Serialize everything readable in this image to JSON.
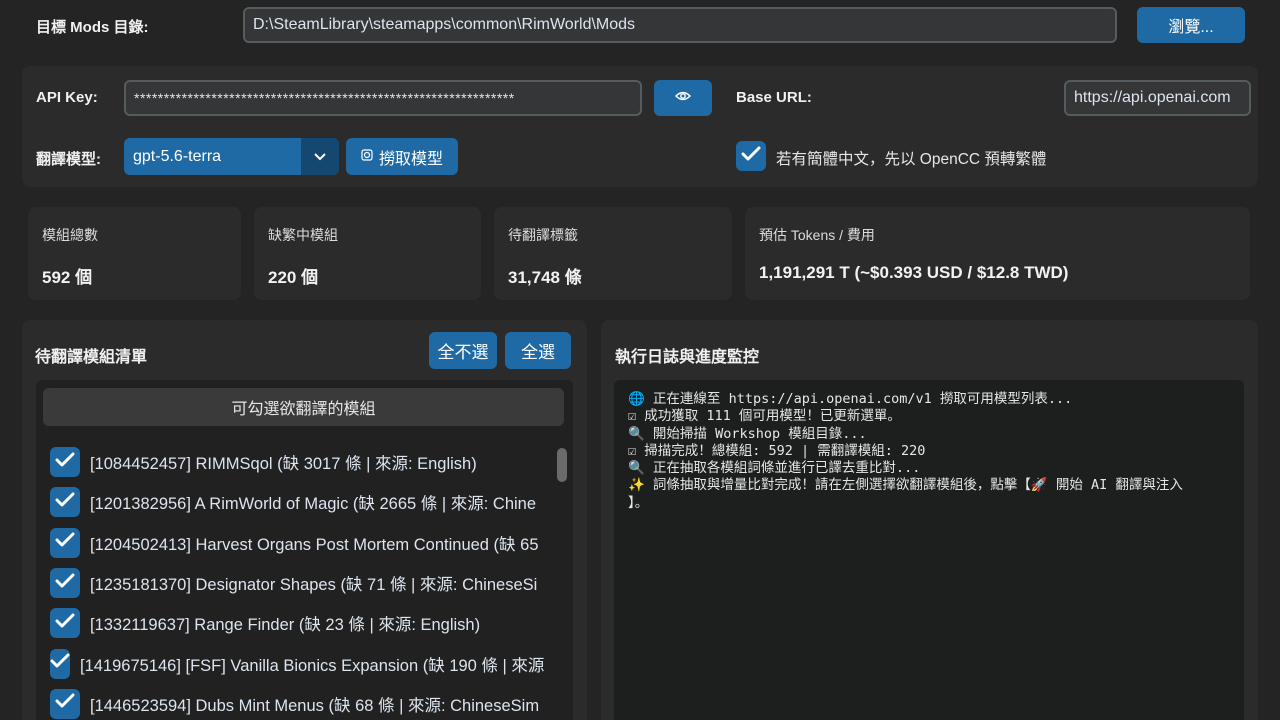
{
  "mods_dir": {
    "label": "目標 Mods 目錄:",
    "value": "D:\\SteamLibrary\\steamapps\\common\\RimWorld\\Mods",
    "browse_label": "瀏覽..."
  },
  "api": {
    "key_label": "API Key:",
    "key_value": "****************************************************************",
    "eye_icon": "eye-icon",
    "base_url_label": "Base URL:",
    "base_url_value": "https://api.openai.com",
    "model_label": "翻譯模型:",
    "model_value": "gpt-5.6-terra",
    "fetch_label": "撈取模型",
    "fetch_icon": "refresh-icon",
    "opencc_label": "若有簡體中文，先以 OpenCC 預轉繁體",
    "opencc_checked": true
  },
  "stats": [
    {
      "title": "模組總數",
      "value": "592 個"
    },
    {
      "title": "缺繁中模組",
      "value": "220 個"
    },
    {
      "title": "待翻譯標籤",
      "value": "31,748 條"
    },
    {
      "title": "預估 Tokens / 費用",
      "value": "1,191,291 T (~$0.393 USD / $12.8 TWD)"
    }
  ],
  "modlist": {
    "title": "待翻譯模組清單",
    "deselect_all": "全不選",
    "select_all": "全選",
    "header": "可勾選欲翻譯的模組",
    "items": [
      {
        "label": "[1084452457] RIMMSqol (缺 3017 條 | 來源: English)",
        "checked": true
      },
      {
        "label": "[1201382956] A RimWorld of Magic (缺 2665 條 | 來源: Chine",
        "checked": true
      },
      {
        "label": "[1204502413] Harvest Organs Post Mortem Continued (缺 65",
        "checked": true
      },
      {
        "label": "[1235181370] Designator Shapes (缺 71 條 | 來源: ChineseSi",
        "checked": true
      },
      {
        "label": "[1332119637] Range Finder (缺 23 條 | 來源: English)",
        "checked": true
      },
      {
        "label": "[1419675146] [FSF] Vanilla Bionics Expansion (缺 190 條 | 來源",
        "checked": true
      },
      {
        "label": "[1446523594] Dubs Mint Menus (缺 68 條 | 來源: ChineseSim",
        "checked": true
      }
    ]
  },
  "log": {
    "title": "執行日誌與進度監控",
    "lines": [
      "🌐 正在連線至 https://api.openai.com/v1 撈取可用模型列表...",
      "☑ 成功獲取 111 個可用模型！已更新選單。",
      "🔍 開始掃描 Workshop 模組目錄...",
      "☑ 掃描完成！總模組: 592 | 需翻譯模組: 220",
      "🔍 正在抽取各模組詞條並進行已譯去重比對...",
      "✨ 詞條抽取與增量比對完成！請在左側選擇欲翻譯模組後，點擊【🚀 開始 AI 翻譯與注入",
      "】。"
    ]
  },
  "colors": {
    "accent": "#1f6aa5",
    "bg": "#242424",
    "panel": "#2b2b2b"
  }
}
